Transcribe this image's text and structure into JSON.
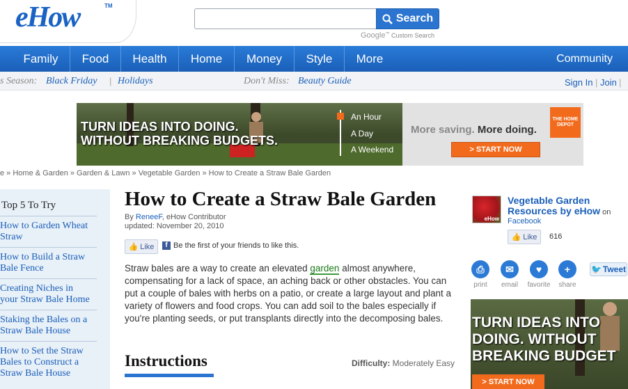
{
  "header": {
    "logo": "eHow",
    "logo_tm": "TM",
    "search_placeholder": "",
    "search_button": "Search",
    "google_label": "Google",
    "custom_search": "Custom Search"
  },
  "nav": {
    "items": [
      "Family",
      "Food",
      "Health",
      "Home",
      "Money",
      "Style",
      "More"
    ],
    "community": "Community"
  },
  "subnav": {
    "season_label": "s Season:",
    "season_links": [
      "Black Friday",
      "Holidays"
    ],
    "dont_miss_label": "Don't Miss:",
    "dont_miss_link": "Beauty Guide",
    "sign_in": "Sign In",
    "join": "Join"
  },
  "ad_banner": {
    "headline_1": "TURN IDEAS INTO DOING.",
    "headline_2": "WITHOUT BREAKING BUDGETS.",
    "timeline": [
      "An Hour",
      "A Day",
      "A Weekend"
    ],
    "saving_1": "More saving.",
    "saving_2": "More doing.",
    "logo_text": "THE HOME DEPOT",
    "cta": "> START NOW",
    "accent_color": "#f26b1d"
  },
  "breadcrumb": "e » Home & Garden » Garden & Lawn » Vegetable Garden » How to Create a Straw Bale Garden",
  "sidebar": {
    "title": "Top 5 To Try",
    "items": [
      [
        "How to Garden Wheat",
        "Straw"
      ],
      [
        "How to Build a Straw",
        "Bale Fence"
      ],
      [
        "Creating Niches in",
        "your Straw Bale Home"
      ],
      [
        "Staking the Bales on a",
        "Straw Bale House"
      ],
      [
        "How to Set the Straw",
        "Bales to Construct a",
        "Straw Bale House"
      ]
    ]
  },
  "article": {
    "title": "How to Create a Straw Bale Garden",
    "by": "By ",
    "author": "ReneeF",
    "author_role": ", eHow Contributor",
    "updated": "updated: November 20, 2010",
    "like": "Like",
    "friends_text": "Be the first of your friends to like this.",
    "intro_before": "Straw bales are a way to create an elevated ",
    "intro_link": "garden",
    "intro_after": " almost anywhere, compensating for a lack of space, an aching back or other obstacles. You can put a couple of bales with herbs on a patio, or create a large layout and plant a variety of flowers and food crops. You can add soil to the bales especially if you're planting seeds, or put transplants directly into the decomposing bales.",
    "instructions_heading": "Instructions",
    "difficulty_label": "Difficulty:",
    "difficulty_value": " Moderately Easy"
  },
  "right": {
    "thumb_label": "eHow",
    "resources_title": "Vegetable Garden Resources by eHow",
    "on": " on",
    "facebook": "Facebook",
    "like": "Like",
    "like_count": "616",
    "share": [
      "print",
      "email",
      "favorite",
      "share"
    ],
    "tweet": "Tweet",
    "ad_lines": [
      "TURN IDEAS INTO",
      "DOING. WITHOUT",
      "BREAKING BUDGET"
    ],
    "ad_cta": "> START NOW"
  },
  "colors": {
    "nav_blue": "#1a63c4",
    "link_blue": "#1a5fb8",
    "sidebar_bg": "#e8f0f8"
  }
}
